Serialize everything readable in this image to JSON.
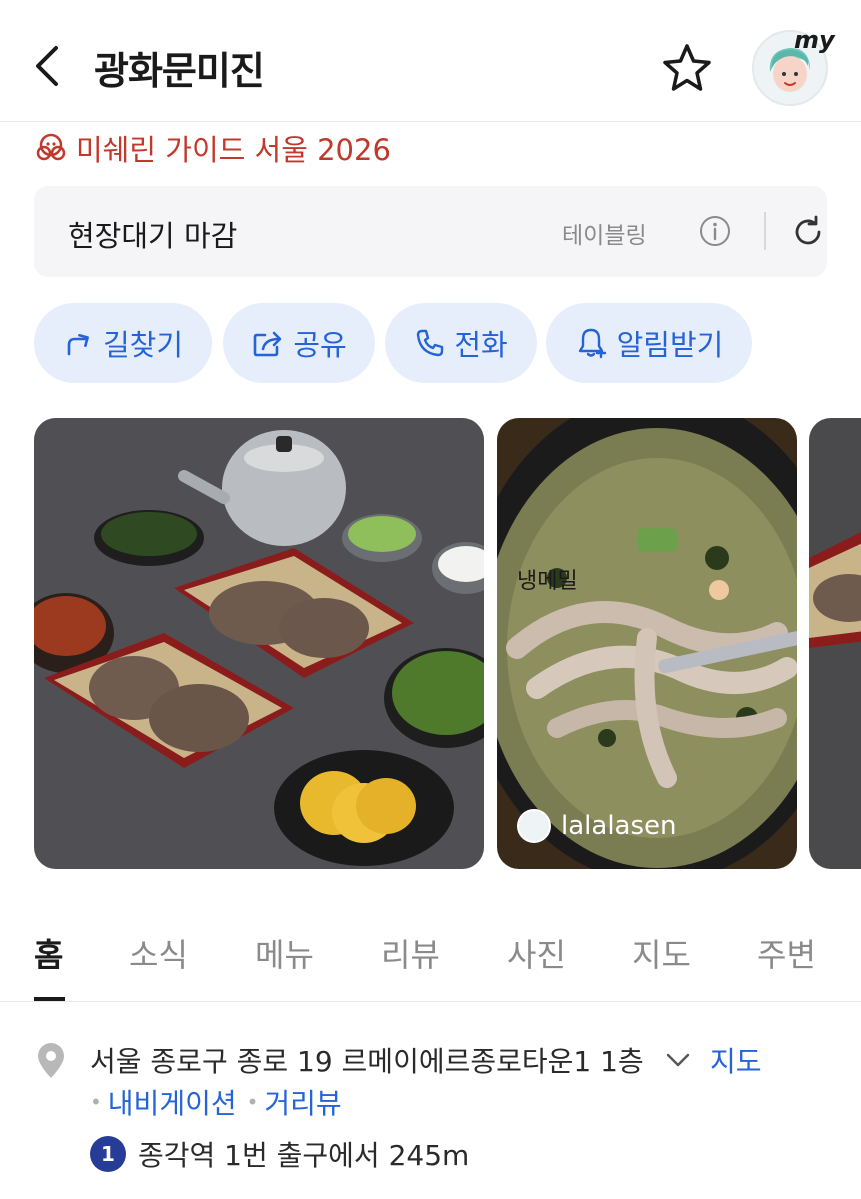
{
  "header": {
    "title": "광화문미진",
    "profile_badge": "my"
  },
  "michelin": {
    "label": "미쉐린 가이드 서울 2026"
  },
  "status": {
    "text": "현장대기 마감",
    "provider": "테이블링"
  },
  "actions": [
    {
      "label": "길찾기",
      "icon": "directions-icon"
    },
    {
      "label": "공유",
      "icon": "share-icon"
    },
    {
      "label": "전화",
      "icon": "phone-icon"
    },
    {
      "label": "알림받기",
      "icon": "bell-plus-icon"
    }
  ],
  "photos": {
    "photo2_overlay": "냉메밀",
    "photo2_user": "lalalasen"
  },
  "tabs": [
    {
      "label": "홈",
      "active": true
    },
    {
      "label": "소식"
    },
    {
      "label": "메뉴"
    },
    {
      "label": "리뷰"
    },
    {
      "label": "사진"
    },
    {
      "label": "지도"
    },
    {
      "label": "주변"
    }
  ],
  "address": {
    "text": "서울 종로구 종로 19 르메이에르종로타운1 1층",
    "map_link": "지도",
    "navigation_link": "내비게이션",
    "streetview_link": "거리뷰"
  },
  "subway": {
    "line": "1",
    "text": "종각역 1번 출구에서 245m"
  },
  "colors": {
    "accent": "#2563d8",
    "michelin": "#c0392b",
    "line1": "#263c96",
    "pill_bg": "#e6eefb"
  }
}
